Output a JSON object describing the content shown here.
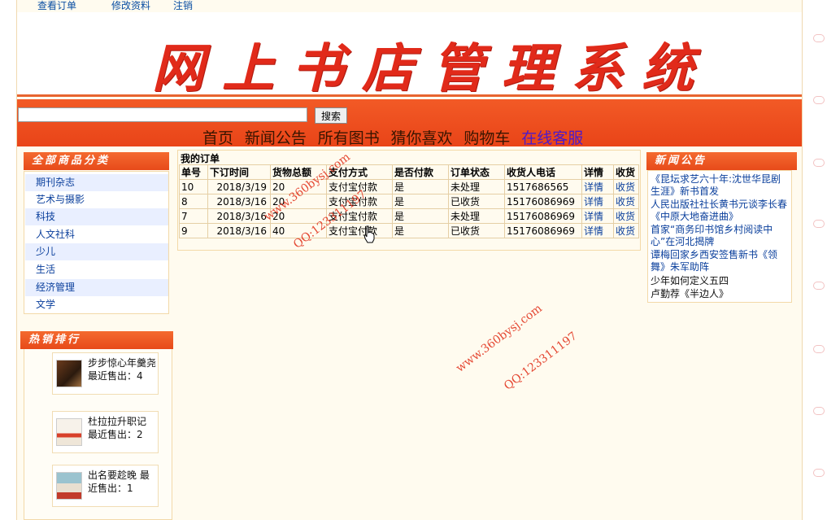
{
  "top_links": [
    "查看订单",
    "修改资料",
    "注销"
  ],
  "banner": {
    "title": "网上书店管理系统"
  },
  "search": {
    "placeholder": "",
    "button_label": "搜索"
  },
  "nav": {
    "items": [
      "首页",
      "新闻公告",
      "所有图书",
      "猜你喜欢",
      "购物车"
    ],
    "online_service": "在线客服"
  },
  "categories": {
    "title": "全部商品分类",
    "items": [
      "期刊杂志",
      "艺术与摄影",
      "科技",
      "人文社科",
      "少儿",
      "生活",
      "经济管理",
      "文学"
    ]
  },
  "hot": {
    "title": "热销排行",
    "items": [
      {
        "text": "步步惊心年羹尧 最近售出：4"
      },
      {
        "text": "杜拉拉升职记 最近售出：2"
      },
      {
        "text": "出名要趁晚 最近售出：1"
      }
    ]
  },
  "orders": {
    "title": "我的订单",
    "columns": [
      "单号",
      "下订时间",
      "货物总额",
      "支付方式",
      "是否付款",
      "订单状态",
      "收货人电话",
      "详情",
      "收货"
    ],
    "rows": [
      [
        "10",
        "2018/3/19",
        "20",
        "支付宝付款",
        "是",
        "未处理",
        "1517686565",
        "详情",
        "收货"
      ],
      [
        "8",
        "2018/3/16",
        "20",
        "支付宝付款",
        "是",
        "已收货",
        "15176086969",
        "详情",
        "收货"
      ],
      [
        "7",
        "2018/3/16",
        "20",
        "支付宝付款",
        "是",
        "未处理",
        "15176086969",
        "详情",
        "收货"
      ],
      [
        "9",
        "2018/3/16",
        "40",
        "支付宝付款",
        "是",
        "已收货",
        "15176086969",
        "详情",
        "收货"
      ]
    ]
  },
  "news": {
    "title": "新闻公告",
    "items": [
      "《昆坛求艺六十年:沈世华昆剧生涯》新书首发",
      "人民出版社社长黄书元谈李长春《中原大地奋进曲》",
      "首家“商务印书馆乡村阅读中心”在河北揭牌",
      "谭梅回家乡西安签售新书《领舞》朱军助阵",
      "少年如何定义五四",
      "卢勤荐《半边人》"
    ]
  },
  "watermarks": [
    "www.360bysj.com",
    "QQ:123311197",
    "www.360bysj.com",
    "QQ:123311197"
  ],
  "colors": {
    "accent": "#e94418",
    "banner_text": "#e12a1a",
    "link": "#0a3f9c"
  }
}
